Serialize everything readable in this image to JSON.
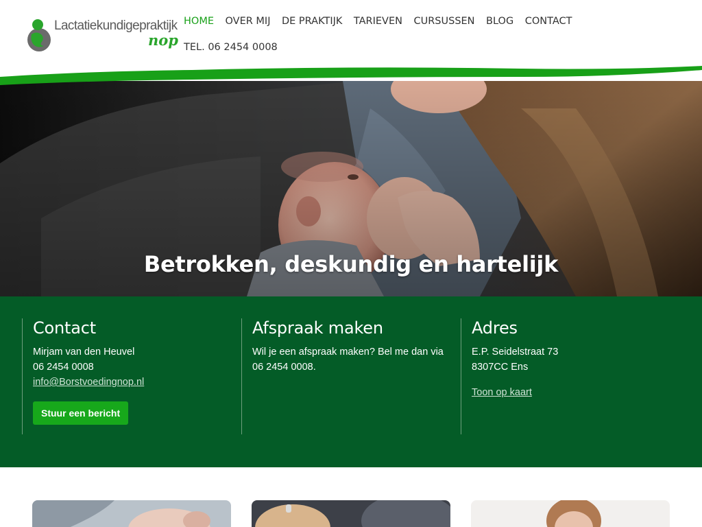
{
  "header": {
    "logo": {
      "name": "Lactatiekundigepraktijk",
      "sub": "nop"
    },
    "nav": [
      {
        "label": "HOME",
        "active": true
      },
      {
        "label": "OVER MIJ",
        "active": false
      },
      {
        "label": "DE PRAKTIJK",
        "active": false
      },
      {
        "label": "TARIEVEN",
        "active": false
      },
      {
        "label": "CURSUSSEN",
        "active": false
      },
      {
        "label": "BLOG",
        "active": false
      },
      {
        "label": "CONTACT",
        "active": false
      }
    ],
    "tel": "TEL. 06 2454 0008"
  },
  "hero": {
    "title": "Betrokken, deskundig en hartelijk"
  },
  "info": {
    "contact": {
      "heading": "Contact",
      "name": "Mirjam van den Heuvel",
      "phone": "06 2454 0008",
      "email": "info@Borstvoedingnop.nl",
      "button": "Stuur een bericht"
    },
    "appointment": {
      "heading": "Afspraak maken",
      "line1": "Wil je een afspraak maken? Bel me dan via",
      "line2": "06 2454 0008."
    },
    "address": {
      "heading": "Adres",
      "street": "E.P. Seidelstraat 73",
      "city": "8307CC Ens",
      "map_link": "Toon op kaart"
    }
  },
  "colors": {
    "brand_green": "#18a018",
    "band_green": "#045c27",
    "button_green": "#17a81b"
  }
}
